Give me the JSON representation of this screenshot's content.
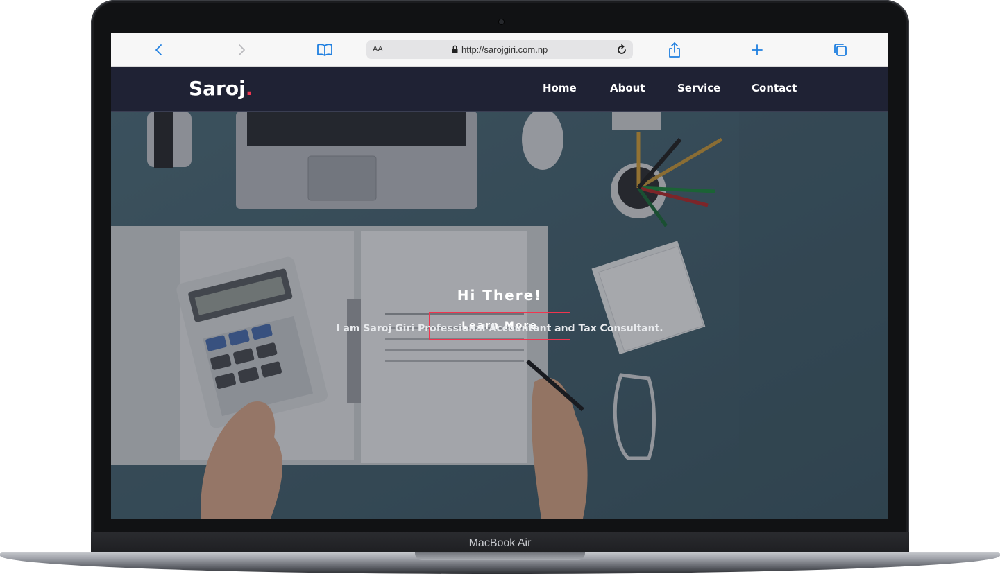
{
  "device": {
    "label": "MacBook Air"
  },
  "browser": {
    "address_prefix": "AA",
    "url": "http://sarojgiri.com.np",
    "icons": [
      "back-icon",
      "forward-icon",
      "bookmarks-icon",
      "lock-icon",
      "reload-icon",
      "share-icon",
      "new-tab-icon",
      "tabs-icon"
    ],
    "accent_color": "#1f7fe0"
  },
  "site": {
    "logo_text": "Saroj",
    "logo_dot": ".",
    "accent_color": "#f0354f",
    "nav": [
      {
        "label": "Home"
      },
      {
        "label": "About"
      },
      {
        "label": "Service"
      },
      {
        "label": "Contact"
      }
    ]
  },
  "hero": {
    "title": "Hi There!",
    "subtitle": "I am Saroj Giri Professional Accountant and Tax Consultant.",
    "button_label": "Learn More"
  }
}
